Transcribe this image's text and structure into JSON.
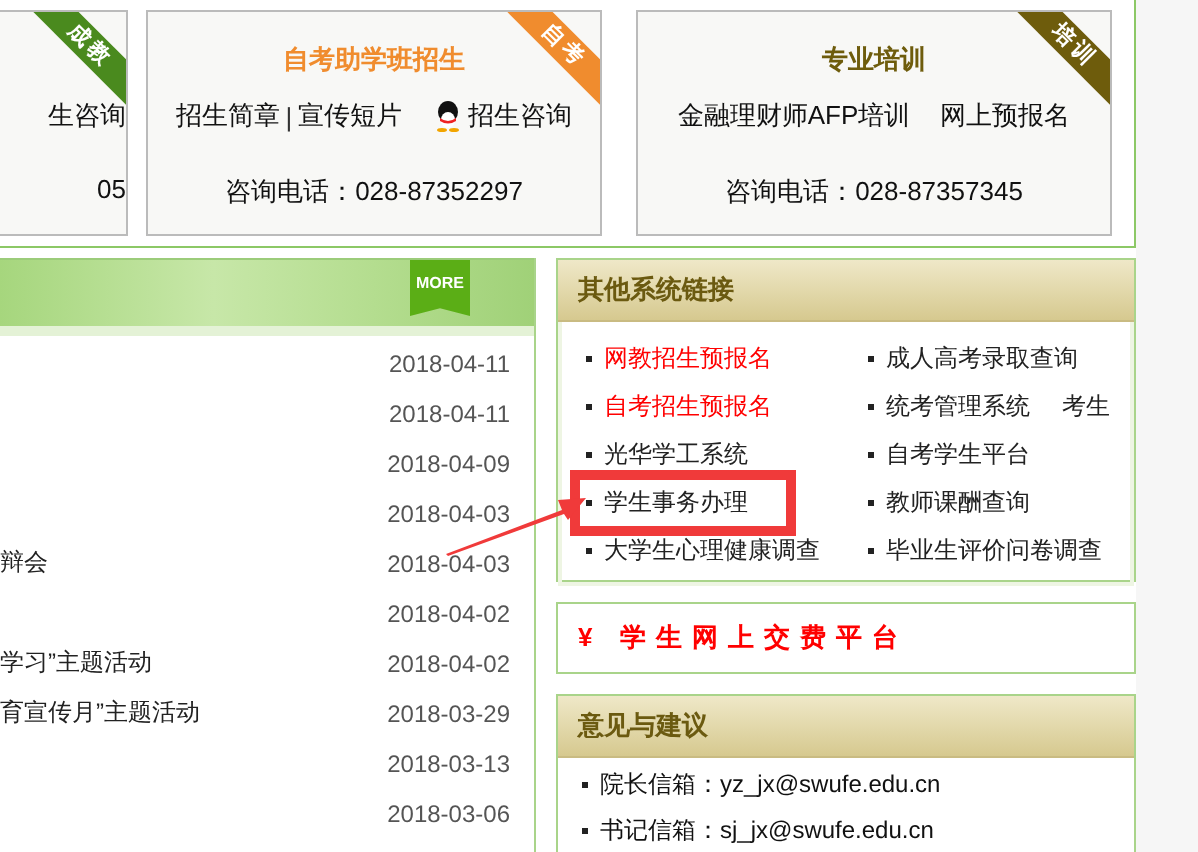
{
  "top_cards": [
    {
      "ribbon": "成教",
      "color": "#4a8a1e",
      "links": [
        {
          "kind": "text",
          "label": "生咨询"
        }
      ],
      "phone": "05"
    },
    {
      "ribbon": "自考",
      "color": "#f08c2e",
      "title": "自考助学班招生",
      "links": [
        {
          "kind": "text",
          "label": "招生简章"
        },
        {
          "kind": "separator",
          "label": "|"
        },
        {
          "kind": "text",
          "label": "宣传短片"
        },
        {
          "kind": "chat",
          "label": "招生咨询"
        }
      ],
      "phone": "咨询电话：028-87352297"
    },
    {
      "ribbon": "培训",
      "color": "#6e5c0c",
      "title": "专业培训",
      "links": [
        {
          "kind": "text",
          "label": "金融理财师AFP培训"
        },
        {
          "kind": "text",
          "label": "网上预报名"
        }
      ],
      "phone": "咨询电话：028-87357345"
    }
  ],
  "news": {
    "more": "MORE",
    "rows": [
      {
        "date": "2018-04-11"
      },
      {
        "date": "2018-04-11"
      },
      {
        "date": "2018-04-09"
      },
      {
        "date": "2018-04-03"
      },
      {
        "title": "辩会",
        "date": "2018-04-03"
      },
      {
        "date": "2018-04-02"
      },
      {
        "title": "学习”主题活动",
        "date": "2018-04-02"
      },
      {
        "title": "育宣传月”主题活动",
        "date": "2018-03-29"
      },
      {
        "date": "2018-03-13"
      },
      {
        "date": "2018-03-06"
      }
    ]
  },
  "links_panel": {
    "title": "其他系统链接",
    "items": [
      {
        "labels": [
          "网教招生预报名"
        ],
        "color": "#ff0000",
        "highlighted": false
      },
      {
        "labels": [
          "成人高考录取查询"
        ],
        "color": "#222222",
        "highlighted": false
      },
      {
        "labels": [
          "自考招生预报名"
        ],
        "color": "#ff0000",
        "highlighted": false
      },
      {
        "labels": [
          "统考管理系统",
          "考生"
        ],
        "color": "#222222",
        "highlighted": false
      },
      {
        "labels": [
          "光华学工系统"
        ],
        "color": "#222222",
        "highlighted": false
      },
      {
        "labels": [
          "自考学生平台"
        ],
        "color": "#222222",
        "highlighted": false
      },
      {
        "labels": [
          "学生事务办理"
        ],
        "color": "#222222",
        "highlighted": true
      },
      {
        "labels": [
          "教师课酬查询"
        ],
        "color": "#222222",
        "highlighted": false
      },
      {
        "labels": [
          "大学生心理健康调查"
        ],
        "color": "#222222",
        "highlighted": false
      },
      {
        "labels": [
          "毕业生评价问卷调查"
        ],
        "color": "#222222",
        "highlighted": false
      }
    ]
  },
  "fee_panel": {
    "label": "¥ 学生网上交费平台"
  },
  "suggestions": {
    "title": "意见与建议",
    "items": [
      "院长信箱：yz_jx@swufe.edu.cn",
      "书记信箱：sj_jx@swufe.edu.cn"
    ]
  }
}
